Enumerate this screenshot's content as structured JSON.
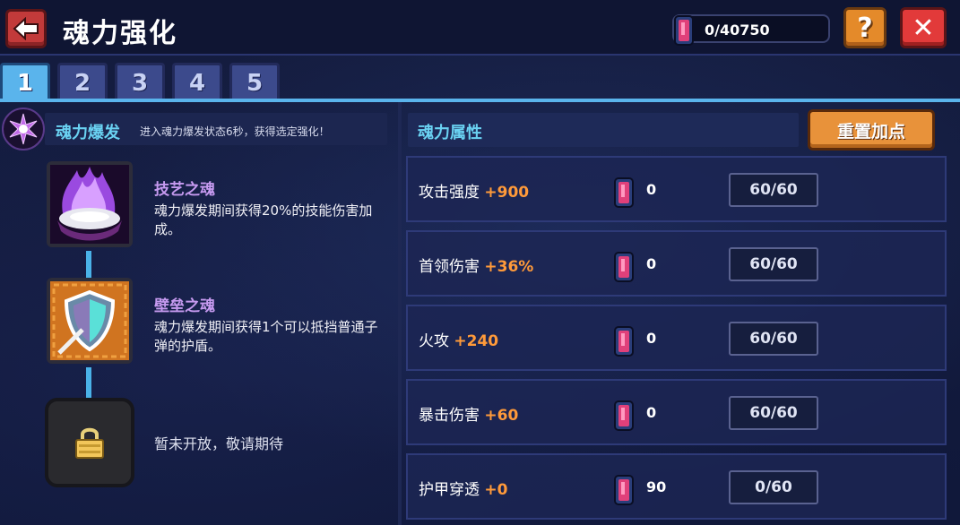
{
  "header": {
    "title": "魂力强化",
    "currency_value": "0/40750",
    "help_label": "?",
    "close_label": "✕"
  },
  "tabs": [
    {
      "label": "1",
      "active": true
    },
    {
      "label": "2",
      "active": false
    },
    {
      "label": "3",
      "active": false
    },
    {
      "label": "4",
      "active": false
    },
    {
      "label": "5",
      "active": false
    }
  ],
  "burst": {
    "title": "魂力爆发",
    "description": "进入魂力爆发状态6秒，获得选定强化！"
  },
  "skills": [
    {
      "name": "技艺之魂",
      "description": "魂力爆发期间获得20%的技能伤害加成。",
      "icon": "purple-flame-shell-icon"
    },
    {
      "name": "壁垒之魂",
      "description": "魂力爆发期间获得1个可以抵挡普通子弹的护盾。",
      "icon": "shield-icon"
    }
  ],
  "locked": {
    "text": "暂未开放，敬请期待",
    "icon": "lock-icon"
  },
  "attributes": {
    "title": "魂力属性",
    "reset_label": "重置加点",
    "rows": [
      {
        "name": "攻击强度",
        "bonus": "+900",
        "cost": "0",
        "level": "60/60"
      },
      {
        "name": "首领伤害",
        "bonus": "+36%",
        "cost": "0",
        "level": "60/60"
      },
      {
        "name": "火攻",
        "bonus": "+240",
        "cost": "0",
        "level": "60/60"
      },
      {
        "name": "暴击伤害",
        "bonus": "+60",
        "cost": "0",
        "level": "60/60"
      },
      {
        "name": "护甲穿透",
        "bonus": "+0",
        "cost": "90",
        "level": "0/60"
      }
    ]
  },
  "colors": {
    "accent_blue": "#5ab4ec",
    "bonus_orange": "#ff9a3a",
    "title_cyan": "#6ad2f2",
    "skill_purple": "#c69af0"
  }
}
